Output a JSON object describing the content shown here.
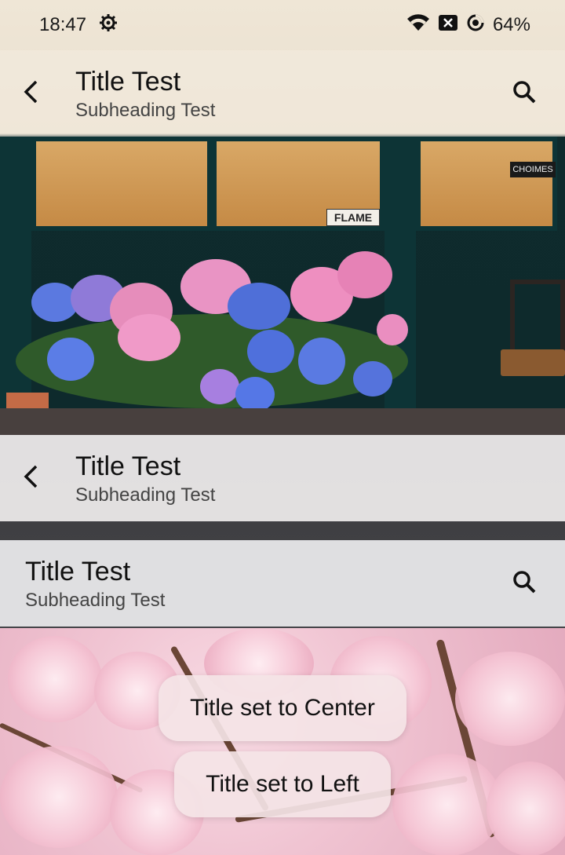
{
  "status_bar": {
    "time": "18:47",
    "battery": "64%",
    "icons": [
      "settings-gear-icon",
      "wifi-icon",
      "notification-x-icon",
      "battery-saver-icon"
    ]
  },
  "app_bars": [
    {
      "title": "Title Test",
      "subtitle": "Subheading Test",
      "has_back": true,
      "has_search": true
    },
    {
      "title": "Title Test",
      "subtitle": "Subheading Test",
      "has_back": true,
      "has_search": false
    },
    {
      "title": "Title Test",
      "subtitle": "Subheading Test",
      "has_back": false,
      "has_search": true
    }
  ],
  "toasts": {
    "center": "Title set to Center",
    "left": "Title set to Left"
  },
  "photo_text": {
    "shop_sign": "FLAME",
    "window_sign": "CHOIMES"
  },
  "colors": {
    "door_green": "#0d3436",
    "blossom_pink": "#f2c3d2",
    "toast_bg": "#f4e4e6"
  }
}
